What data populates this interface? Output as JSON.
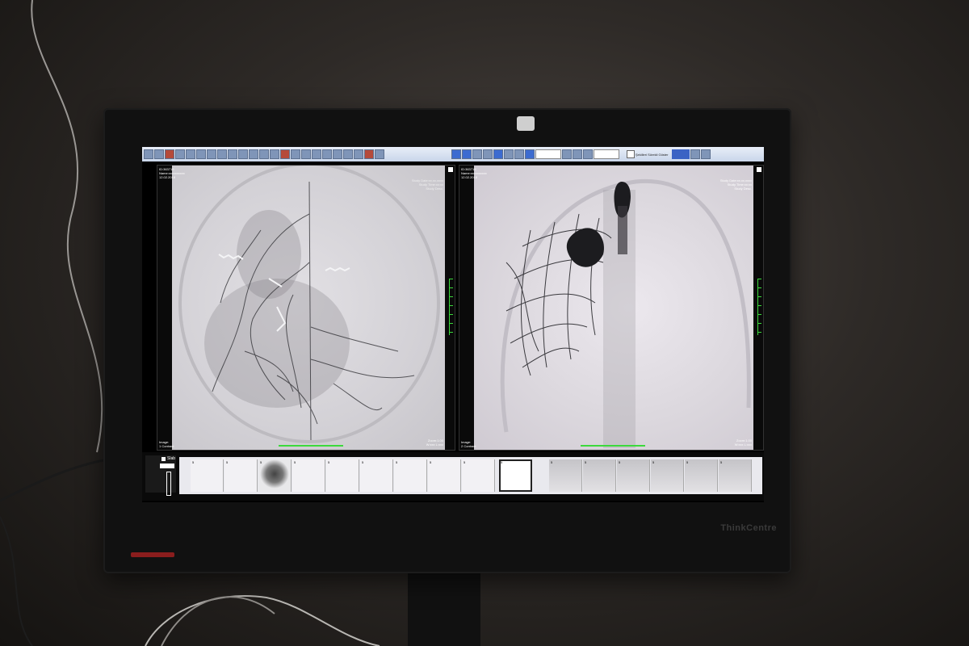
{
  "viewer": {
    "toolbar": {
      "overlay_checkbox_label": "Şekilleri Sürekli Göster"
    },
    "viewport1": {
      "overlay_top_left": [
        "ID:363719",
        "Name:xxxxxxxxxx",
        "12.02.2018"
      ],
      "overlay_top_right": [
        "Study Date:xx.xx.xxxx",
        "Study Time:xx:xx",
        "Study Desc."
      ],
      "overlay_bottom_left": [
        "Image:",
        "1 Contrast"
      ],
      "overlay_bottom_right": [
        "Zoom:1.00",
        "W:xxx L:xxx"
      ]
    },
    "viewport2": {
      "overlay_top_left": [
        "ID:363719",
        "Name:xxxxxxxxxx",
        "12.02.2018"
      ],
      "overlay_top_right": [
        "Study Date:xx.xx.xxxx",
        "Study Time:xx:xx",
        "Study Desc."
      ],
      "overlay_bottom_left": [
        "Image:",
        "2 Contrast"
      ],
      "overlay_bottom_right": [
        "Zoom:1.00",
        "W:xxx L:xxx"
      ]
    },
    "thumbnails": {
      "slab_label": "Slab",
      "thumb_labels": [
        "5",
        "5",
        "5",
        "5",
        "5",
        "5",
        "5",
        "5",
        "5",
        "5",
        "5",
        "5",
        "5",
        "5",
        "5",
        "5",
        "5"
      ]
    }
  },
  "monitor": {
    "brand": "ThinkCentre"
  }
}
